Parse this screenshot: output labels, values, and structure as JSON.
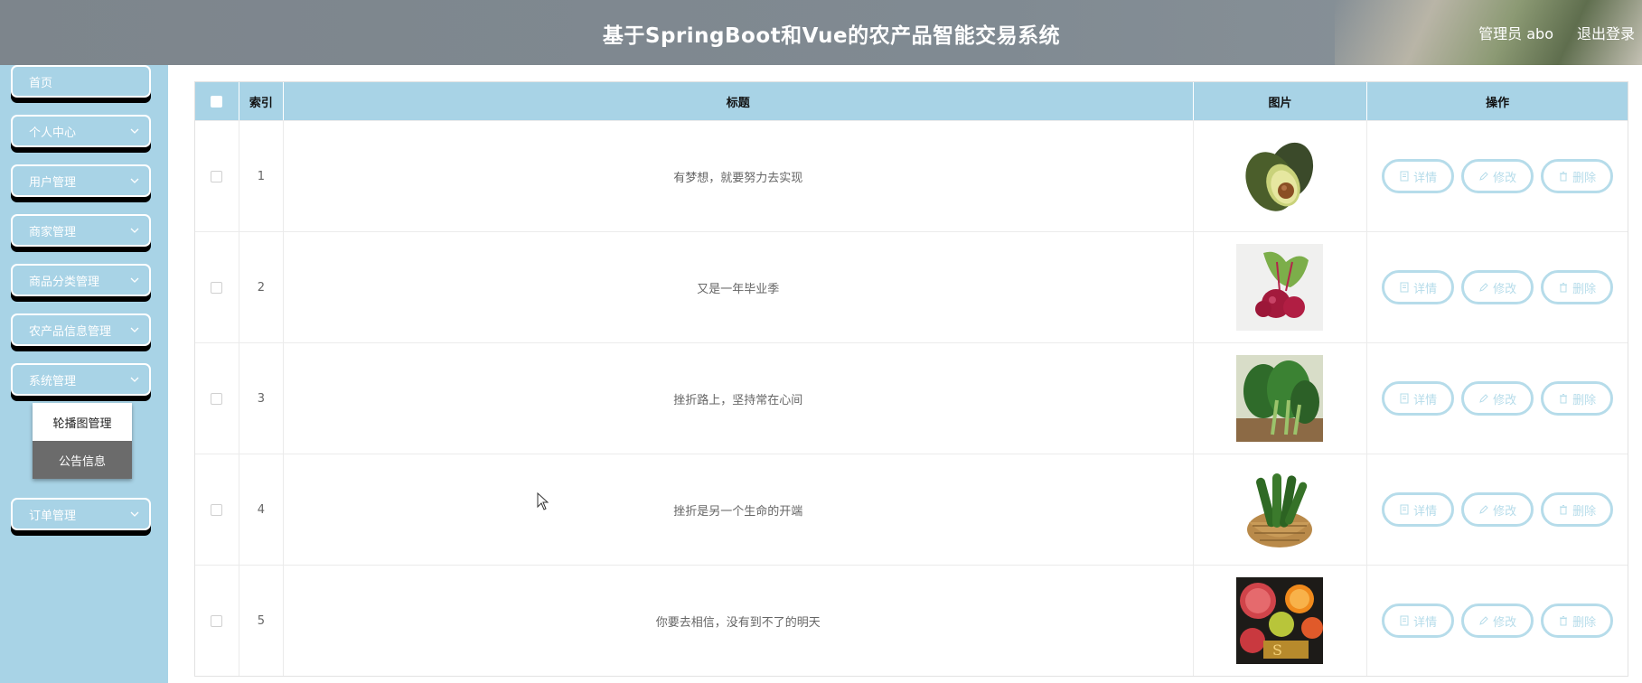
{
  "header": {
    "title": "基于SpringBoot和Vue的农产品智能交易系统",
    "user_label": "管理员 abo",
    "logout_label": "退出登录"
  },
  "sidebar": {
    "items": [
      {
        "label": "首页",
        "icon": "none"
      },
      {
        "label": "个人中心",
        "icon": "chevron-down-icon"
      },
      {
        "label": "用户管理",
        "icon": "chevron-down-icon"
      },
      {
        "label": "商家管理",
        "icon": "chevron-down-icon"
      },
      {
        "label": "商品分类管理",
        "icon": "chevron-down-icon"
      },
      {
        "label": "农产品信息管理",
        "icon": "chevron-down-icon"
      },
      {
        "label": "系统管理",
        "icon": "chevron-down-icon"
      },
      {
        "label": "订单管理",
        "icon": "chevron-down-icon"
      }
    ],
    "submenu": [
      "轮播图管理",
      "公告信息"
    ]
  },
  "table": {
    "columns": [
      "索引",
      "标题",
      "图片",
      "操作"
    ],
    "rows": [
      {
        "index": "1",
        "title": "有梦想，就要努力去实现",
        "image": "avocado"
      },
      {
        "index": "2",
        "title": "又是一年毕业季",
        "image": "beetroot"
      },
      {
        "index": "3",
        "title": "挫折路上，坚持常在心间",
        "image": "leafy-greens"
      },
      {
        "index": "4",
        "title": "挫折是另一个生命的开端",
        "image": "cucumber-basket"
      },
      {
        "index": "5",
        "title": "你要去相信，没有到不了的明天",
        "image": "sliced-fruit"
      }
    ],
    "actions": {
      "detail": "详情",
      "edit": "修改",
      "delete": "删除"
    }
  },
  "colors": {
    "header_bg": "#808a92",
    "sidebar_bg": "#a8d3e6",
    "table_header_bg": "#a8d3e6",
    "action_border": "#b6dcea",
    "submenu_active_bg": "#6b6b6b"
  }
}
